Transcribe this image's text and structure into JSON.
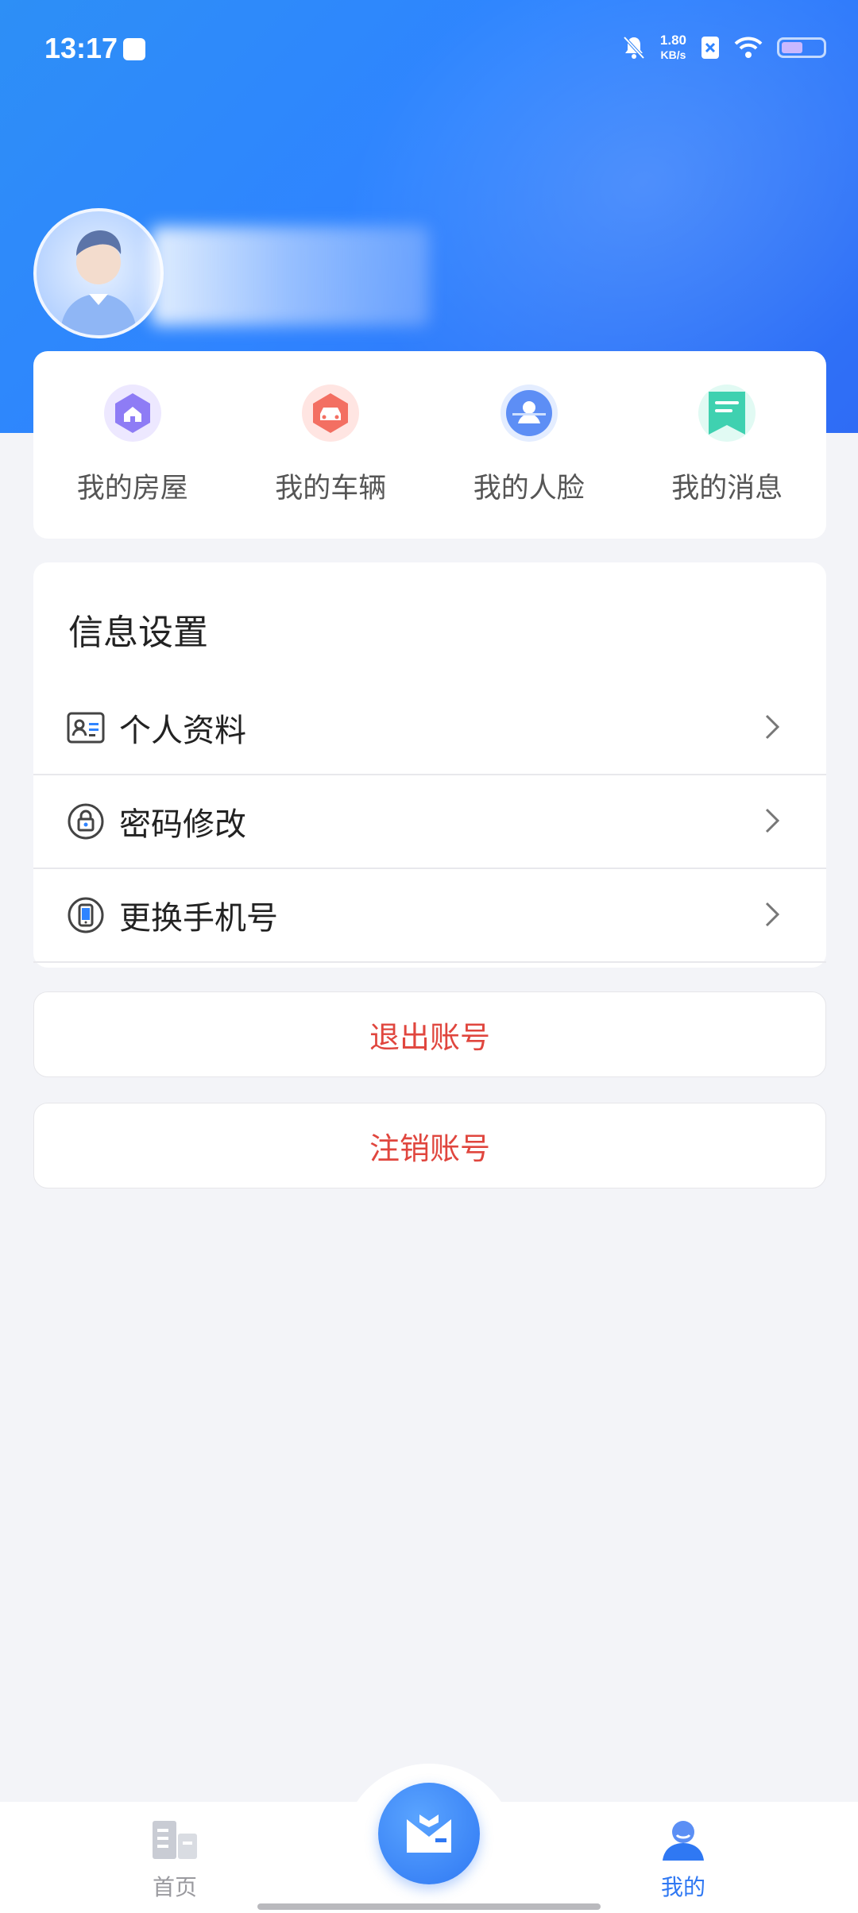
{
  "status_bar": {
    "time": "13:17",
    "net_speed_value": "1.80",
    "net_speed_unit": "KB/s"
  },
  "profile": {
    "avatar_icon": "user-avatar"
  },
  "quick_actions": [
    {
      "label": "我的房屋",
      "icon": "house-icon",
      "color": "#8e7cf5"
    },
    {
      "label": "我的车辆",
      "icon": "car-icon",
      "color": "#f36f62"
    },
    {
      "label": "我的人脸",
      "icon": "face-icon",
      "color": "#5d8ef5"
    },
    {
      "label": "我的消息",
      "icon": "message-icon",
      "color": "#3fd1b0"
    }
  ],
  "settings": {
    "title": "信息设置",
    "items": [
      {
        "label": "个人资料",
        "icon": "id-card-icon"
      },
      {
        "label": "密码修改",
        "icon": "lock-icon"
      },
      {
        "label": "更换手机号",
        "icon": "phone-icon"
      }
    ]
  },
  "actions": {
    "logout": "退出账号",
    "deactivate": "注销账号"
  },
  "bottom_nav": {
    "home": "首页",
    "mine": "我的"
  },
  "colors": {
    "header_blue": "#2f84ff",
    "danger_text": "#e0463e",
    "active_nav": "#2f78f3"
  }
}
